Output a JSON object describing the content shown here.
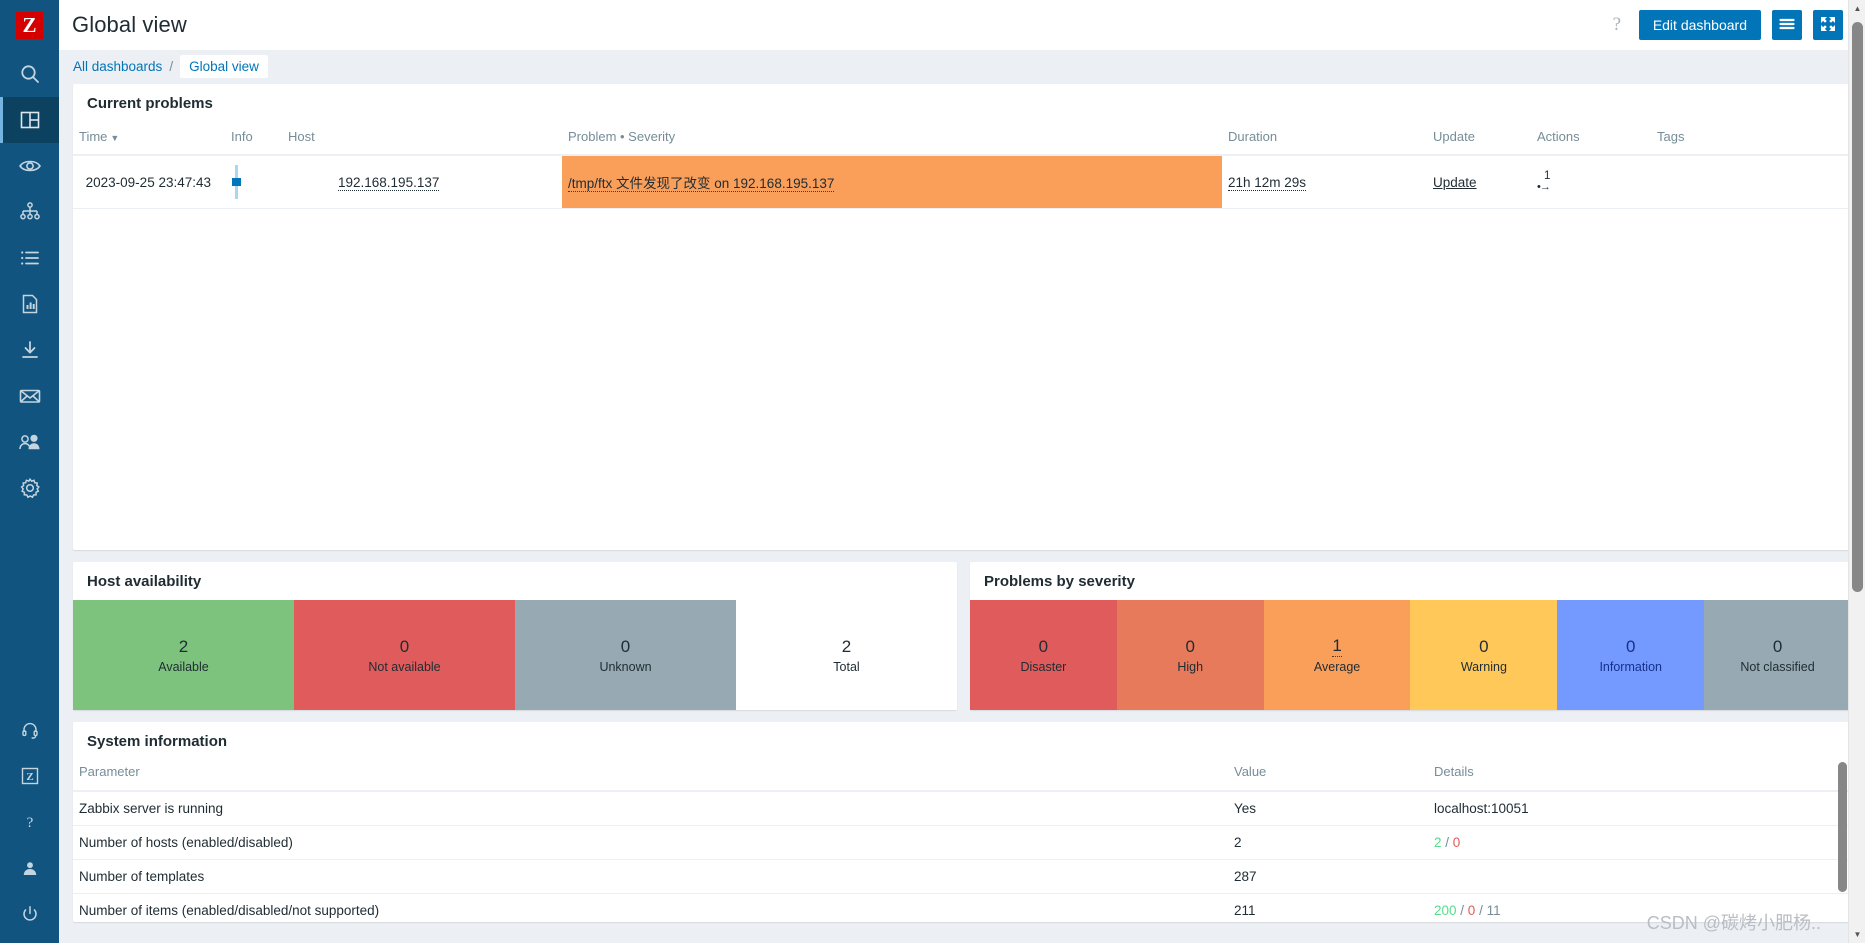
{
  "brand": {
    "logo_letter": "Z",
    "accent": "#0275b8",
    "sidebar_bg": "#10547f",
    "logo_bg": "#d40000"
  },
  "sidebar": {
    "items": [
      {
        "icon": "search-icon",
        "name": "search"
      },
      {
        "icon": "dashboard-grid-icon",
        "name": "dashboards",
        "active": true
      },
      {
        "icon": "eye-monitoring-icon",
        "name": "monitoring"
      },
      {
        "icon": "services-hierarchy-icon",
        "name": "services"
      },
      {
        "icon": "inventory-list-icon",
        "name": "inventory"
      },
      {
        "icon": "reports-chart-icon",
        "name": "reports"
      },
      {
        "icon": "data-collection-download-icon",
        "name": "data-collection"
      },
      {
        "icon": "alerts-envelope-icon",
        "name": "alerts"
      },
      {
        "icon": "users-group-icon",
        "name": "users"
      },
      {
        "icon": "administration-gear-icon",
        "name": "administration"
      }
    ],
    "bottom_items": [
      {
        "icon": "support-headset-icon",
        "name": "support"
      },
      {
        "icon": "zabbix-integrations-icon",
        "name": "integrations"
      },
      {
        "icon": "help-question-icon",
        "name": "help"
      },
      {
        "icon": "user-profile-icon",
        "name": "user-settings"
      },
      {
        "icon": "power-signout-icon",
        "name": "sign-out"
      }
    ]
  },
  "header": {
    "title": "Global view",
    "help_label": "?",
    "edit_dashboard_label": "Edit dashboard",
    "kebab_icon": "hamburger-menu-icon",
    "fullscreen_icon": "expand-fullscreen-icon"
  },
  "breadcrumb": {
    "all_dashboards": "All dashboards",
    "separator": "/",
    "current": "Global view"
  },
  "problems_widget": {
    "title": "Current problems",
    "columns": [
      "Time",
      "Info",
      "Host",
      "Problem • Severity",
      "Duration",
      "Update",
      "Actions",
      "Tags"
    ],
    "sort_column": "Time",
    "sort_caret": "▼",
    "rows": [
      {
        "time": "2023-09-25 23:47:43",
        "info": "",
        "host": "192.168.195.137",
        "problem": "/tmp/ftx 文件发现了改变 on 192.168.195.137",
        "severity": "Average",
        "severity_color": "#fa9f5a",
        "duration": "21h 12m 29s",
        "update": "Update",
        "actions_count": "1",
        "tags": ""
      }
    ]
  },
  "host_availability": {
    "title": "Host availability",
    "blocks": [
      {
        "value": "2",
        "label": "Available",
        "color": "#7dc37d"
      },
      {
        "value": "0",
        "label": "Not available",
        "color": "#e05c5c"
      },
      {
        "value": "0",
        "label": "Unknown",
        "color": "#97aab3"
      },
      {
        "value": "2",
        "label": "Total",
        "color": "#ffffff"
      }
    ]
  },
  "problems_by_severity": {
    "title": "Problems by severity",
    "blocks": [
      {
        "value": "0",
        "label": "Disaster",
        "color": "#e05c5c",
        "linked": false
      },
      {
        "value": "0",
        "label": "High",
        "color": "#e77a5a",
        "linked": false
      },
      {
        "value": "1",
        "label": "Average",
        "color": "#fa9f5a",
        "linked": true
      },
      {
        "value": "0",
        "label": "Warning",
        "color": "#ffc859",
        "linked": false
      },
      {
        "value": "0",
        "label": "Information",
        "color": "#7499ff",
        "linked": false
      },
      {
        "value": "0",
        "label": "Not classified",
        "color": "#97aab3",
        "linked": false
      }
    ]
  },
  "system_information": {
    "title": "System information",
    "columns": [
      "Parameter",
      "Value",
      "Details"
    ],
    "rows": [
      {
        "parameter": "Zabbix server is running",
        "value": "Yes",
        "value_state": "ok",
        "details": [
          {
            "text": "localhost:10051",
            "color": "normal"
          }
        ]
      },
      {
        "parameter": "Number of hosts (enabled/disabled)",
        "value": "2",
        "value_state": "normal",
        "details": [
          {
            "text": "2",
            "color": "green"
          },
          {
            "text": " / ",
            "color": "sep"
          },
          {
            "text": "0",
            "color": "red"
          }
        ]
      },
      {
        "parameter": "Number of templates",
        "value": "287",
        "value_state": "normal",
        "details": []
      },
      {
        "parameter": "Number of items (enabled/disabled/not supported)",
        "value": "211",
        "value_state": "normal",
        "details": [
          {
            "text": "200",
            "color": "green"
          },
          {
            "text": " / ",
            "color": "sep"
          },
          {
            "text": "0",
            "color": "red"
          },
          {
            "text": " / ",
            "color": "sep"
          },
          {
            "text": "11",
            "color": "grey"
          }
        ]
      }
    ]
  },
  "watermark": {
    "text": "CSDN @碳烤小肥杨.."
  },
  "scrollbars": {
    "up_arrow": "▲",
    "down_arrow": "▼"
  }
}
